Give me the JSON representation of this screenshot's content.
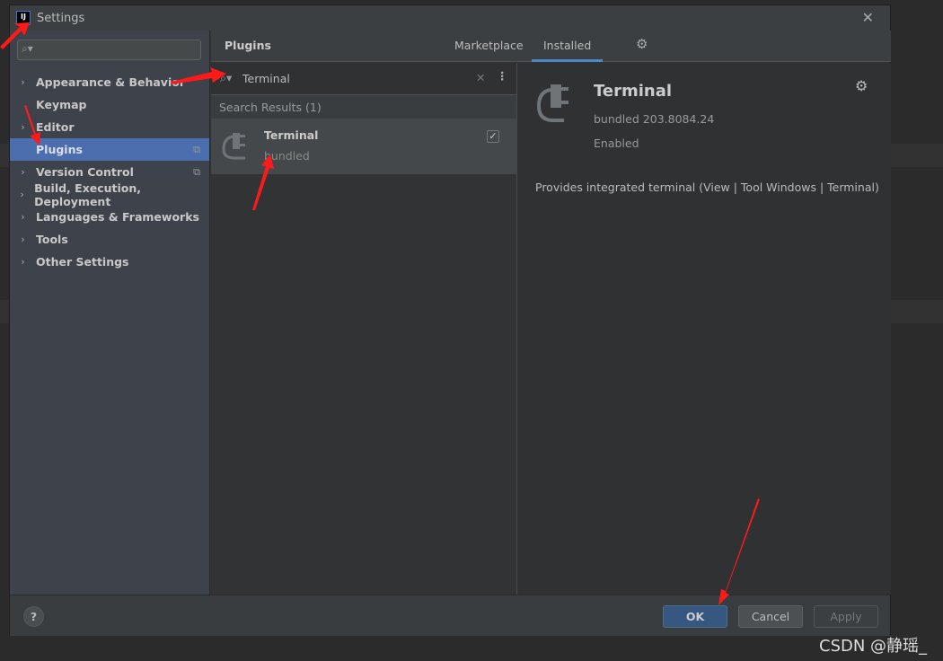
{
  "window": {
    "title": "Settings",
    "logo": "IJ",
    "close": "✕"
  },
  "sidebar": {
    "search_placeholder": "",
    "items": [
      {
        "label": "Appearance & Behavior",
        "chevron": true
      },
      {
        "label": "Keymap",
        "chevron": false
      },
      {
        "label": "Editor",
        "chevron": true
      },
      {
        "label": "Plugins",
        "chevron": false,
        "selected": true
      },
      {
        "label": "Version Control",
        "chevron": true
      },
      {
        "label": "Build, Execution, Deployment",
        "chevron": true
      },
      {
        "label": "Languages & Frameworks",
        "chevron": true
      },
      {
        "label": "Tools",
        "chevron": true
      },
      {
        "label": "Other Settings",
        "chevron": true
      }
    ]
  },
  "header": {
    "title": "Plugins",
    "tabs": [
      {
        "label": "Marketplace"
      },
      {
        "label": "Installed",
        "active": true
      }
    ]
  },
  "list": {
    "search_value": "Terminal",
    "results_label": "Search Results (1)",
    "plugins": [
      {
        "name": "Terminal",
        "subtitle": "bundled",
        "enabled": true
      }
    ]
  },
  "detail": {
    "name": "Terminal",
    "version": "bundled 203.8084.24",
    "status": "Enabled",
    "description": "Provides integrated terminal (View | Tool Windows | Terminal)"
  },
  "footer": {
    "help": "?",
    "ok": "OK",
    "cancel": "Cancel",
    "apply": "Apply"
  },
  "watermark": "CSDN @静瑶_",
  "colors": {
    "accent": "#4b6eaf",
    "annotation_arrow": "#ff1a1a"
  }
}
